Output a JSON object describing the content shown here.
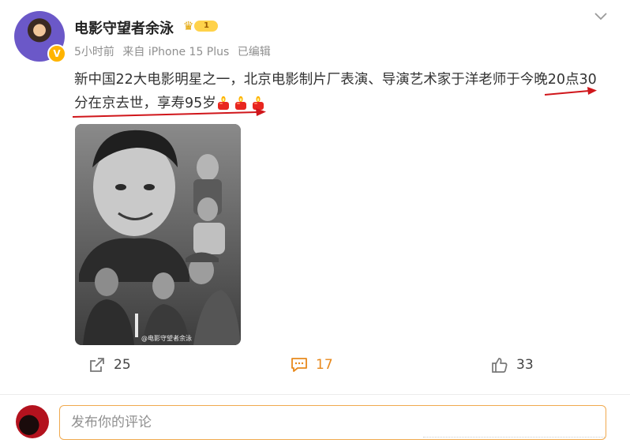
{
  "user": {
    "name": "电影守望者余泳",
    "rank_level": "1",
    "verified_mark": "V"
  },
  "meta": {
    "time": "5小时前",
    "source": "来自 iPhone 15 Plus",
    "edited": "已编辑"
  },
  "post": {
    "text": "新中国22大电影明星之一，北京电影制片厂表演、导演艺术家于洋老师于今晚20点30分在京去世，享寿95岁",
    "emoji": [
      "candle-icon",
      "candle-icon",
      "candle-icon"
    ]
  },
  "image": {
    "watermark": "@电影守望者余泳"
  },
  "actions": {
    "repost_count": "25",
    "comment_count": "17",
    "like_count": "33"
  },
  "comment": {
    "placeholder": "发布你的评论"
  },
  "colors": {
    "accent": "#e8891c",
    "annotation_red": "#d0161b",
    "text": "#333333",
    "meta": "#8f8f8f"
  }
}
